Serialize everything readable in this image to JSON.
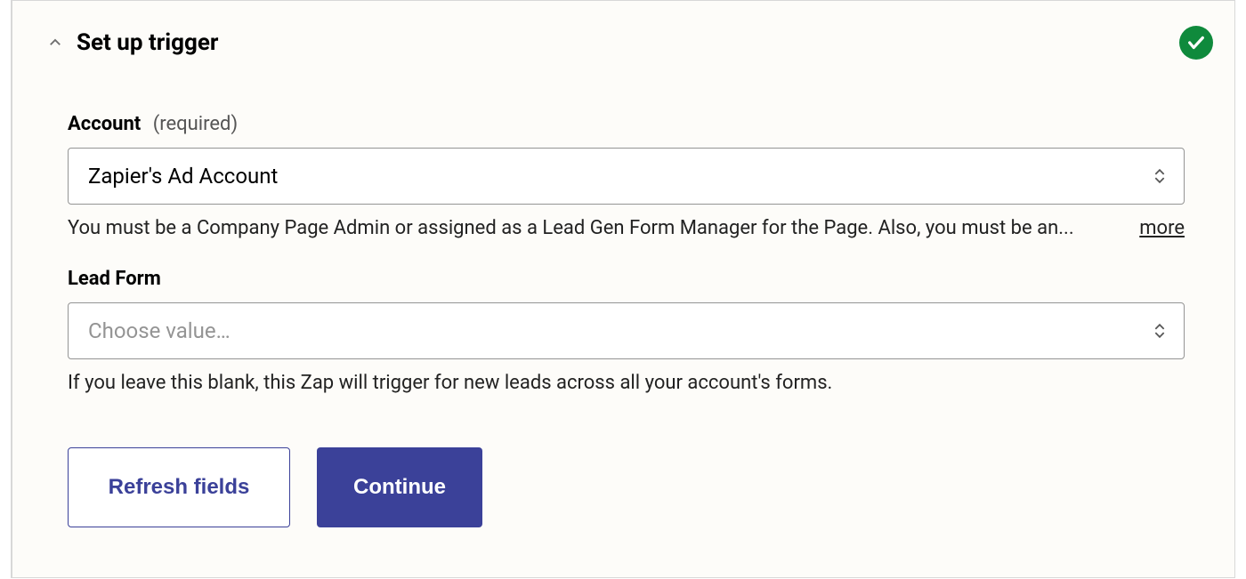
{
  "header": {
    "title": "Set up trigger"
  },
  "fields": {
    "account": {
      "label": "Account",
      "required_text": "(required)",
      "value": "Zapier's Ad Account",
      "helper": "You must be a Company Page Admin or assigned as a Lead Gen Form Manager for the Page. Also, you must be an...",
      "more_label": "more"
    },
    "lead_form": {
      "label": "Lead Form",
      "placeholder": "Choose value…",
      "helper": "If you leave this blank, this Zap will trigger for new leads across all your account's forms."
    }
  },
  "buttons": {
    "refresh": "Refresh fields",
    "continue": "Continue"
  }
}
